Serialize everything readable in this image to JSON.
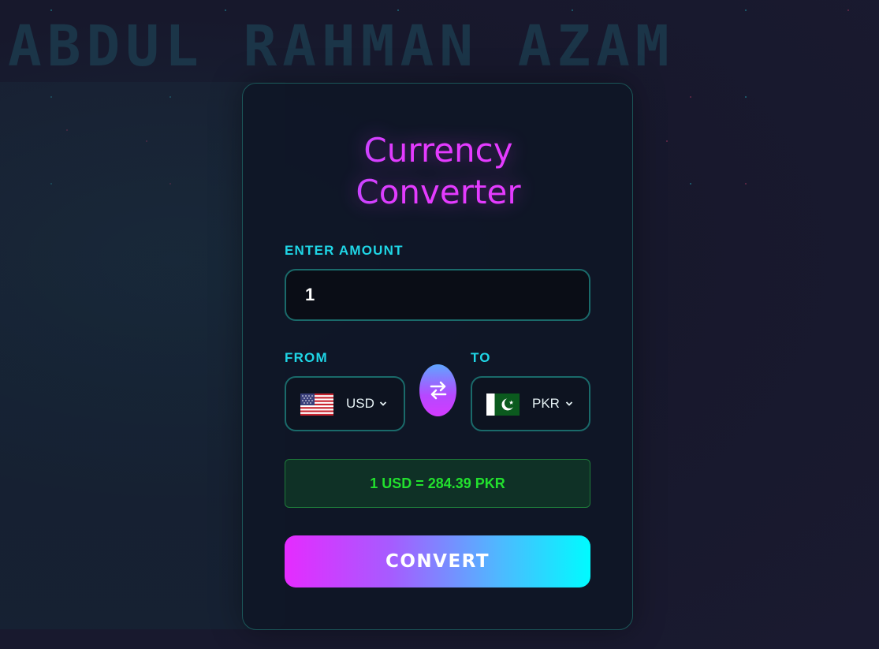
{
  "background": {
    "watermark_text": "ABDUL RAHMAN AZAM"
  },
  "card": {
    "title_line1": "Currency",
    "title_line2": "Converter",
    "amount_label": "ENTER AMOUNT",
    "amount_value": "1",
    "from_label": "FROM",
    "to_label": "TO",
    "from_currency": "USD",
    "to_currency": "PKR",
    "from_flag_icon": "us-flag-icon",
    "to_flag_icon": "pakistan-flag-icon",
    "swap_icon": "swap-arrows-icon",
    "rate_text": "1 USD = 284.39 PKR",
    "convert_label": "CONVERT"
  },
  "colors": {
    "accent_cyan": "#1fd6e6",
    "accent_magenta": "#e43bff",
    "rate_green": "#22e02e",
    "border_teal": "#1a6a6a"
  }
}
